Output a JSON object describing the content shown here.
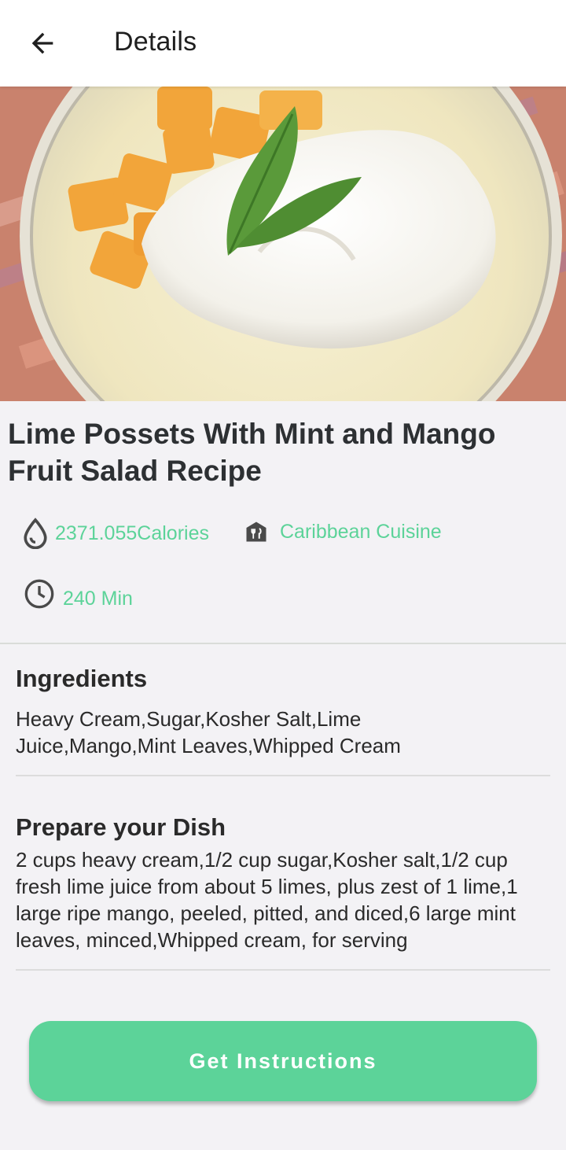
{
  "appbar": {
    "title": "Details",
    "back_icon": "arrow-left-icon"
  },
  "recipe": {
    "title": "Lime Possets With Mint and Mango Fruit Salad Recipe",
    "image_alt": "lime posset with whipped cream, mint and mango"
  },
  "meta": {
    "calories": "2371.055Calories",
    "calories_icon": "drop-icon",
    "cuisine": "Caribbean Cuisine",
    "cuisine_icon": "restaurant-icon",
    "time": "240 Min",
    "time_icon": "clock-icon"
  },
  "ingredients": {
    "heading": "Ingredients",
    "text": "Heavy Cream,Sugar,Kosher Salt,Lime Juice,Mango,Mint Leaves,Whipped Cream"
  },
  "prepare": {
    "heading": "Prepare your Dish",
    "text": "2 cups heavy cream,1/2 cup sugar,Kosher salt,1/2 cup fresh lime juice from about 5 limes, plus zest of 1 lime,1 large ripe mango, peeled, pitted, and diced,6 large mint leaves, minced,Whipped cream, for serving"
  },
  "cta": {
    "label": "Get Instructions"
  },
  "colors": {
    "accent": "#5cd399",
    "background": "#f3f2f5",
    "text": "#2b2b2b"
  }
}
